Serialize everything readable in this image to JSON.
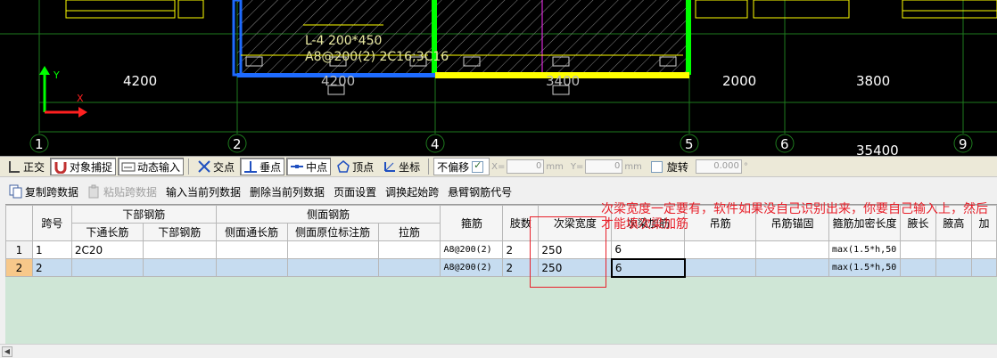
{
  "cad": {
    "dim_labels": [
      "4200",
      "4200",
      "3400",
      "2000",
      "3800",
      "35400"
    ],
    "beam_label": "L-4 200*450",
    "beam_rebar": "A8@200(2) 2C16;3C16",
    "axis_labels": [
      "1",
      "2",
      "4",
      "5",
      "6",
      "9"
    ],
    "ucs_y": "Y",
    "ucs_x": "X"
  },
  "snapbar": {
    "ortho": "正交",
    "object_snap": "对象捕捉",
    "dynamic_input": "动态输入",
    "intersection": "交点",
    "perpendicular": "垂点",
    "midpoint": "中点",
    "vertex": "顶点",
    "coordinate": "坐标",
    "no_offset": "不偏移",
    "x_label": "X=",
    "x_value": "0",
    "x_unit": "mm",
    "y_label": "Y=",
    "y_value": "0",
    "y_unit": "mm",
    "rotate": "旋转",
    "rotate_value": "0.000",
    "degree": "°"
  },
  "toolbar2": {
    "copy_span": "复制跨数据",
    "paste_span": "粘贴跨数据",
    "input_current_col": "输入当前列数据",
    "delete_current_col": "删除当前列数据",
    "page_setup": "页面设置",
    "swap_start_span": "调换起始跨",
    "cantilever_code": "悬臂钢筋代号"
  },
  "grid": {
    "headers": {
      "span_no": "跨号",
      "bottom_rebar": "下部钢筋",
      "bottom_through": "下通长筋",
      "bottom_steel": "下部钢筋",
      "side_rebar": "侧面钢筋",
      "side_through": "侧面通长筋",
      "side_original": "侧面原位标注筋",
      "tie_bar": "拉筋",
      "stirrup": "箍筋",
      "legs": "肢数",
      "sec_beam_width": "次梁宽度",
      "sec_beam_add": "次梁加筋",
      "hanger": "吊筋",
      "hanger_anchor": "吊筋锚固",
      "stirrup_dense_len": "箍筋加密长度",
      "haunch_len": "腋长",
      "haunch_h": "腋高",
      "more": "加"
    },
    "rows": [
      {
        "idx": "1",
        "span": "1",
        "bottom_through": "2C20",
        "stirrup": "A8@200(2)",
        "legs": "2",
        "width": "250",
        "add": "6",
        "dense": "max(1.5*h,50"
      },
      {
        "idx": "2",
        "span": "2",
        "bottom_through": "",
        "stirrup": "A8@200(2)",
        "legs": "2",
        "width": "250",
        "add": "6",
        "dense": "max(1.5*h,50"
      }
    ]
  },
  "annotation": {
    "text": "次梁宽度一定要有，软件如果没自己识别出来，你要自己输入上，然后才能填次梁加筋"
  },
  "colors": {
    "cad_bg": "#000000",
    "grid_line": "#1e7a1e",
    "beam_yellow": "#ffff00",
    "beam_blue": "#1e6bff",
    "column_green": "#00ff00",
    "dim_text": "#ffffff",
    "annotation_red": "#e8202a",
    "selected_row": "#c6dcf0"
  }
}
